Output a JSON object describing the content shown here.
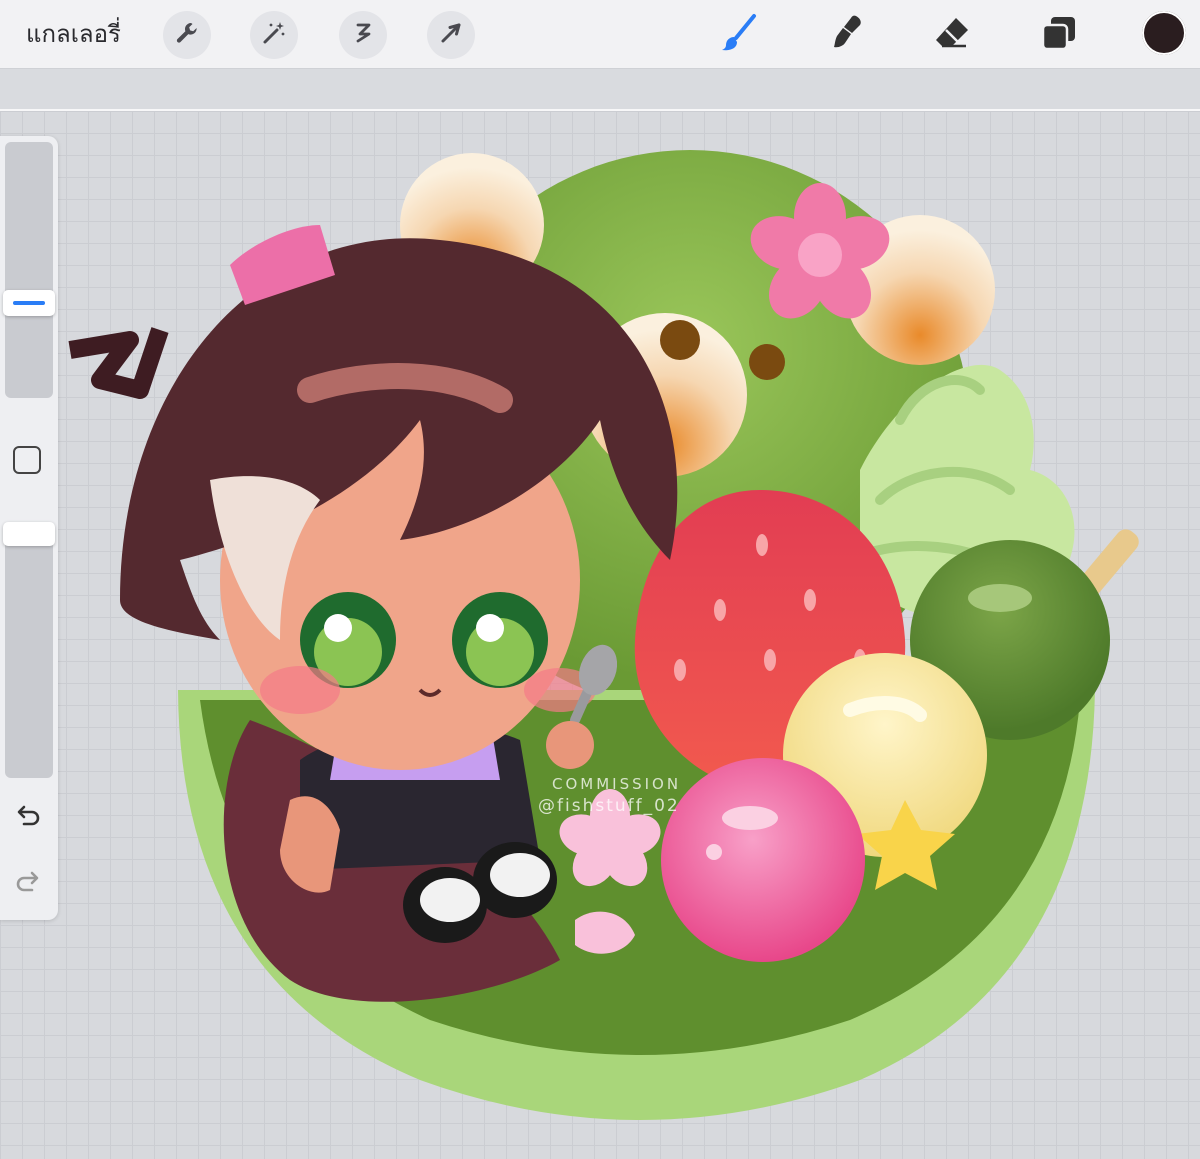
{
  "toolbar": {
    "gallery_label": "แกลเลอรี่",
    "left_tools": [
      "wrench-icon",
      "magic-wand-icon",
      "selection-icon",
      "transform-arrow-icon"
    ],
    "right_tools": [
      "brush-icon",
      "smudge-icon",
      "eraser-icon",
      "layers-icon"
    ],
    "active_tool": "brush-icon",
    "accent_color": "#2a7df6",
    "current_color": "#2a1d1f"
  },
  "sidebar": {
    "tools": [
      "brush-size-slider",
      "modify-button",
      "opacity-slider",
      "undo-icon",
      "redo-icon"
    ]
  },
  "canvas": {
    "watermark_line1": "COMMISSION",
    "watermark_line2": "@fishstuff_02"
  }
}
